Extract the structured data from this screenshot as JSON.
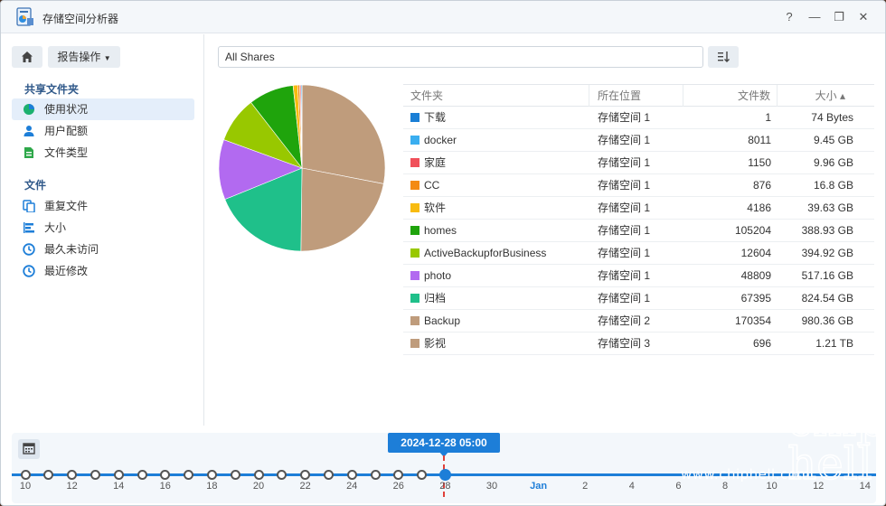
{
  "window": {
    "title": "存储空间分析器",
    "controls": {
      "help": "?",
      "minimize": "—",
      "maximize": "❐",
      "close": "✕"
    }
  },
  "sidebar": {
    "report_button": "报告操作",
    "shared_section": "共享文件夹",
    "shared_items": [
      {
        "label": "使用状况",
        "icon": "pie-chart-icon",
        "color": "#1cb06f",
        "active": true
      },
      {
        "label": "用户配额",
        "icon": "user-icon",
        "color": "#1d7ed8",
        "active": false
      },
      {
        "label": "文件类型",
        "icon": "file-type-icon",
        "color": "#2ea84a",
        "active": false
      }
    ],
    "file_section": "文件",
    "file_items": [
      {
        "label": "重复文件",
        "icon": "duplicate-file-icon",
        "color": "#1d7ed8"
      },
      {
        "label": "大小",
        "icon": "size-bars-icon",
        "color": "#1d7ed8"
      },
      {
        "label": "最久未访问",
        "icon": "clock-icon",
        "color": "#1d7ed8"
      },
      {
        "label": "最近修改",
        "icon": "clock-icon",
        "color": "#1d7ed8"
      }
    ]
  },
  "main": {
    "share_selector": "All Shares",
    "table": {
      "headers": {
        "folder": "文件夹",
        "location": "所在位置",
        "count": "文件数",
        "size": "大小 ▴"
      },
      "rows": [
        {
          "folder": "下载",
          "location": "存储空间 1",
          "count": "1",
          "size": "74 Bytes",
          "color": "#1a7fd6"
        },
        {
          "folder": "docker",
          "location": "存储空间 1",
          "count": "8011",
          "size": "9.45 GB",
          "color": "#3aaef0"
        },
        {
          "folder": "家庭",
          "location": "存储空间 1",
          "count": "1150",
          "size": "9.96 GB",
          "color": "#f0505a"
        },
        {
          "folder": "CC",
          "location": "存储空间 1",
          "count": "876",
          "size": "16.8 GB",
          "color": "#f48a12"
        },
        {
          "folder": "软件",
          "location": "存储空间 1",
          "count": "4186",
          "size": "39.63 GB",
          "color": "#f8bb10"
        },
        {
          "folder": "homes",
          "location": "存储空间 1",
          "count": "105204",
          "size": "388.93 GB",
          "color": "#1fa40c"
        },
        {
          "folder": "ActiveBackupforBusiness",
          "location": "存储空间 1",
          "count": "12604",
          "size": "394.92 GB",
          "color": "#98c800"
        },
        {
          "folder": "photo",
          "location": "存储空间 1",
          "count": "48809",
          "size": "517.16 GB",
          "color": "#b26af0"
        },
        {
          "folder": "归档",
          "location": "存储空间 1",
          "count": "67395",
          "size": "824.54 GB",
          "color": "#1fc08a"
        },
        {
          "folder": "Backup",
          "location": "存储空间 2",
          "count": "170354",
          "size": "980.36 GB",
          "color": "#bf9c7c"
        },
        {
          "folder": "影视",
          "location": "存储空间 3",
          "count": "696",
          "size": "1.21 TB",
          "color": "#bf9c7c"
        }
      ]
    }
  },
  "timeline": {
    "selected": "2024-12-28 05:00",
    "labels": [
      "10",
      "12",
      "14",
      "16",
      "18",
      "20",
      "22",
      "24",
      "26",
      "28",
      "30",
      "Jan",
      "2",
      "4",
      "6",
      "8",
      "10",
      "12",
      "14"
    ],
    "month_label": "Jan"
  },
  "watermark": {
    "text": "www.chiphell.com",
    "logo": "chip hell"
  }
}
